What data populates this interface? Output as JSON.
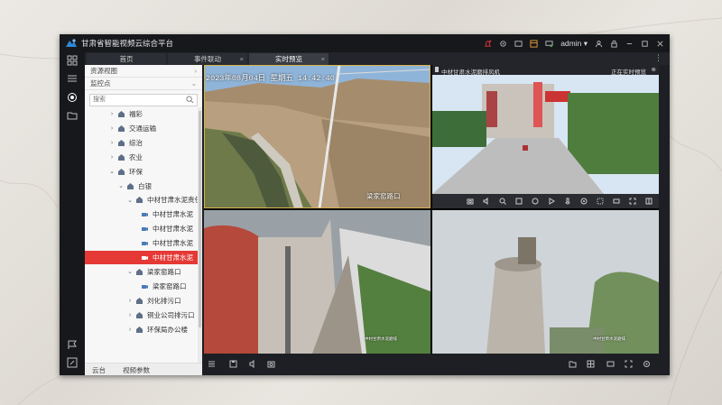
{
  "app": {
    "title": "甘肃省智能视频云综合平台",
    "user": "admin",
    "user_chevron": "▾"
  },
  "tabs": [
    {
      "label": "首页",
      "closable": false,
      "active": false
    },
    {
      "label": "事件联动",
      "closable": true,
      "active": false
    },
    {
      "label": "实时预览",
      "closable": true,
      "active": true
    }
  ],
  "tab_close_glyph": "×",
  "more_glyph": "⋮",
  "panel": {
    "resource_view": "资源视图",
    "monitor_points": "监控点",
    "search_placeholder": "搜索",
    "tree": [
      {
        "label": "福彩",
        "level": 1,
        "expand": "›",
        "icon": "building-icon",
        "selected": false
      },
      {
        "label": "交通运输",
        "level": 1,
        "expand": "›",
        "icon": "building-icon",
        "selected": false
      },
      {
        "label": "综治",
        "level": 1,
        "expand": "›",
        "icon": "building-icon",
        "selected": false
      },
      {
        "label": "农业",
        "level": 1,
        "expand": "›",
        "icon": "building-icon",
        "selected": false
      },
      {
        "label": "环保",
        "level": 1,
        "expand": "⌄",
        "icon": "building-icon",
        "selected": false
      },
      {
        "label": "白银",
        "level": 2,
        "expand": "⌄",
        "icon": "building-icon",
        "selected": false
      },
      {
        "label": "中材甘肃水泥责任",
        "level": 3,
        "expand": "⌄",
        "icon": "building-icon",
        "selected": false
      },
      {
        "label": "中材甘肃水泥",
        "level": 4,
        "expand": "",
        "icon": "camera-icon",
        "selected": false
      },
      {
        "label": "中材甘肃水泥",
        "level": 4,
        "expand": "",
        "icon": "camera-icon",
        "selected": false
      },
      {
        "label": "中材甘肃水泥",
        "level": 4,
        "expand": "",
        "icon": "camera-icon",
        "selected": false
      },
      {
        "label": "中材甘肃水泥",
        "level": 4,
        "expand": "",
        "icon": "camera-icon",
        "selected": true
      },
      {
        "label": "梁家窑路口",
        "level": 3,
        "expand": "⌄",
        "icon": "building-icon",
        "selected": false
      },
      {
        "label": "梁家窑路口",
        "level": 4,
        "expand": "",
        "icon": "camera-icon",
        "selected": false
      },
      {
        "label": "刘化排污口",
        "level": 3,
        "expand": "›",
        "icon": "building-icon",
        "selected": false
      },
      {
        "label": "铜业公司排污口",
        "level": 3,
        "expand": "›",
        "icon": "building-icon",
        "selected": false
      },
      {
        "label": "环保局办公楼",
        "level": 3,
        "expand": "›",
        "icon": "building-icon",
        "selected": false
      }
    ],
    "footer": {
      "ptz": "云台",
      "video_params": "视频参数"
    }
  },
  "channels": [
    {
      "osd_datetime": "2023年08月04日  星期五  14:42:40",
      "osd_name": "梁家窑路口"
    },
    {
      "header_name": "中材甘肃水泥磨排风机",
      "header_status": "正在实时预览",
      "close_glyph": "⊗"
    },
    {
      "osd_small": "中材甘肃水泥磨排"
    },
    {
      "osd_small": "中材甘肃水泥磨排"
    }
  ],
  "colors": {
    "window_bg": "#1d1f24",
    "titlebar_bg": "#17181c",
    "selected_row": "#e53935",
    "accent_icon": "#e8a33b",
    "active_border": "#d8b24a"
  }
}
